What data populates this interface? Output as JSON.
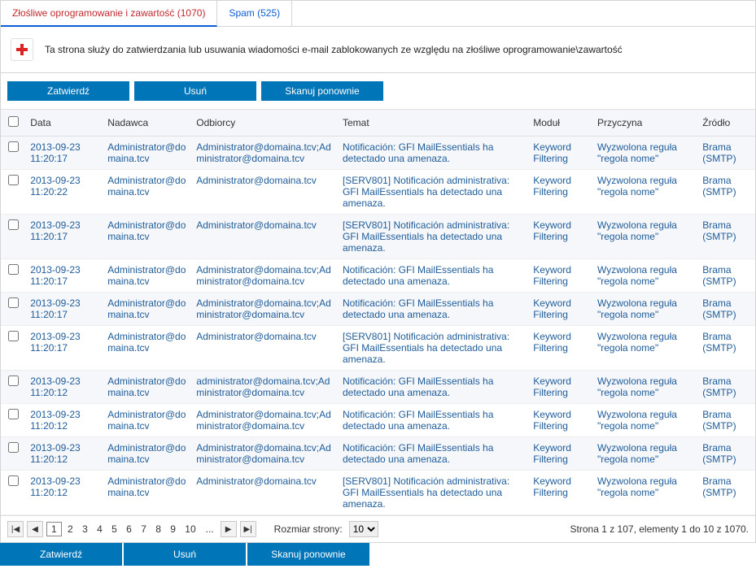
{
  "tabs": {
    "malware": "Złośliwe oprogramowanie i zawartość (1070)",
    "spam": "Spam (525)"
  },
  "info_text": "Ta strona służy do zatwierdzania lub usuwania wiadomości e-mail zablokowanych ze względu na złośliwe oprogramowanie\\zawartość",
  "buttons": {
    "approve": "Zatwierdź",
    "delete": "Usuń",
    "rescan": "Skanuj ponownie"
  },
  "columns": {
    "date": "Data",
    "sender": "Nadawca",
    "recipients": "Odbiorcy",
    "subject": "Temat",
    "module": "Moduł",
    "reason": "Przyczyna",
    "source": "Źródło"
  },
  "rows": [
    {
      "date": "2013-09-23 11:20:17",
      "sender": "Administrator@domaina.tcv",
      "recipients": "Administrator@domaina.tcv;Administrator@domaina.tcv",
      "subject": "Notificación: GFI MailEssentials ha detectado una amenaza.",
      "module": "Keyword Filtering",
      "reason": "Wyzwolona reguła \"regola nome\"",
      "source": "Brama (SMTP)"
    },
    {
      "date": "2013-09-23 11:20:22",
      "sender": "Administrator@domaina.tcv",
      "recipients": "Administrator@domaina.tcv",
      "subject": "[SERV801] Notificación administrativa: GFI MailEssentials ha detectado una amenaza.",
      "module": "Keyword Filtering",
      "reason": "Wyzwolona reguła \"regola nome\"",
      "source": "Brama (SMTP)"
    },
    {
      "date": "2013-09-23 11:20:17",
      "sender": "Administrator@domaina.tcv",
      "recipients": "Administrator@domaina.tcv",
      "subject": "[SERV801] Notificación administrativa: GFI MailEssentials ha detectado una amenaza.",
      "module": "Keyword Filtering",
      "reason": "Wyzwolona reguła \"regola nome\"",
      "source": "Brama (SMTP)"
    },
    {
      "date": "2013-09-23 11:20:17",
      "sender": "Administrator@domaina.tcv",
      "recipients": "Administrator@domaina.tcv;Administrator@domaina.tcv",
      "subject": "Notificación: GFI MailEssentials ha detectado una amenaza.",
      "module": "Keyword Filtering",
      "reason": "Wyzwolona reguła \"regola nome\"",
      "source": "Brama (SMTP)"
    },
    {
      "date": "2013-09-23 11:20:17",
      "sender": "Administrator@domaina.tcv",
      "recipients": "Administrator@domaina.tcv;Administrator@domaina.tcv",
      "subject": "Notificación: GFI MailEssentials ha detectado una amenaza.",
      "module": "Keyword Filtering",
      "reason": "Wyzwolona reguła \"regola nome\"",
      "source": "Brama (SMTP)"
    },
    {
      "date": "2013-09-23 11:20:17",
      "sender": "Administrator@domaina.tcv",
      "recipients": "Administrator@domaina.tcv",
      "subject": "[SERV801] Notificación administrativa: GFI MailEssentials ha detectado una amenaza.",
      "module": "Keyword Filtering",
      "reason": "Wyzwolona reguła \"regola nome\"",
      "source": "Brama (SMTP)"
    },
    {
      "date": "2013-09-23 11:20:12",
      "sender": "Administrator@domaina.tcv",
      "recipients": "administrator@domaina.tcv;Administrator@domaina.tcv",
      "subject": "Notificación: GFI MailEssentials ha detectado una amenaza.",
      "module": "Keyword Filtering",
      "reason": "Wyzwolona reguła \"regola nome\"",
      "source": "Brama (SMTP)"
    },
    {
      "date": "2013-09-23 11:20:12",
      "sender": "Administrator@domaina.tcv",
      "recipients": "Administrator@domaina.tcv;Administrator@domaina.tcv",
      "subject": "Notificación: GFI MailEssentials ha detectado una amenaza.",
      "module": "Keyword Filtering",
      "reason": "Wyzwolona reguła \"regola nome\"",
      "source": "Brama (SMTP)"
    },
    {
      "date": "2013-09-23 11:20:12",
      "sender": "Administrator@domaina.tcv",
      "recipients": "Administrator@domaina.tcv;Administrator@domaina.tcv",
      "subject": "Notificación: GFI MailEssentials ha detectado una amenaza.",
      "module": "Keyword Filtering",
      "reason": "Wyzwolona reguła \"regola nome\"",
      "source": "Brama (SMTP)"
    },
    {
      "date": "2013-09-23 11:20:12",
      "sender": "Administrator@domaina.tcv",
      "recipients": "Administrator@domaina.tcv",
      "subject": "[SERV801] Notificación administrativa: GFI MailEssentials ha detectado una amenaza.",
      "module": "Keyword Filtering",
      "reason": "Wyzwolona reguła \"regola nome\"",
      "source": "Brama (SMTP)"
    }
  ],
  "pager": {
    "first_icon": "|◀",
    "prev_icon": "◀",
    "next_icon": "▶",
    "last_icon": "▶|",
    "pages": [
      "1",
      "2",
      "3",
      "4",
      "5",
      "6",
      "7",
      "8",
      "9",
      "10"
    ],
    "ellipsis": "...",
    "page_size_label": "Rozmiar strony:",
    "page_size_value": "10",
    "status": "Strona 1 z 107, elementy 1 do 10 z 1070."
  }
}
